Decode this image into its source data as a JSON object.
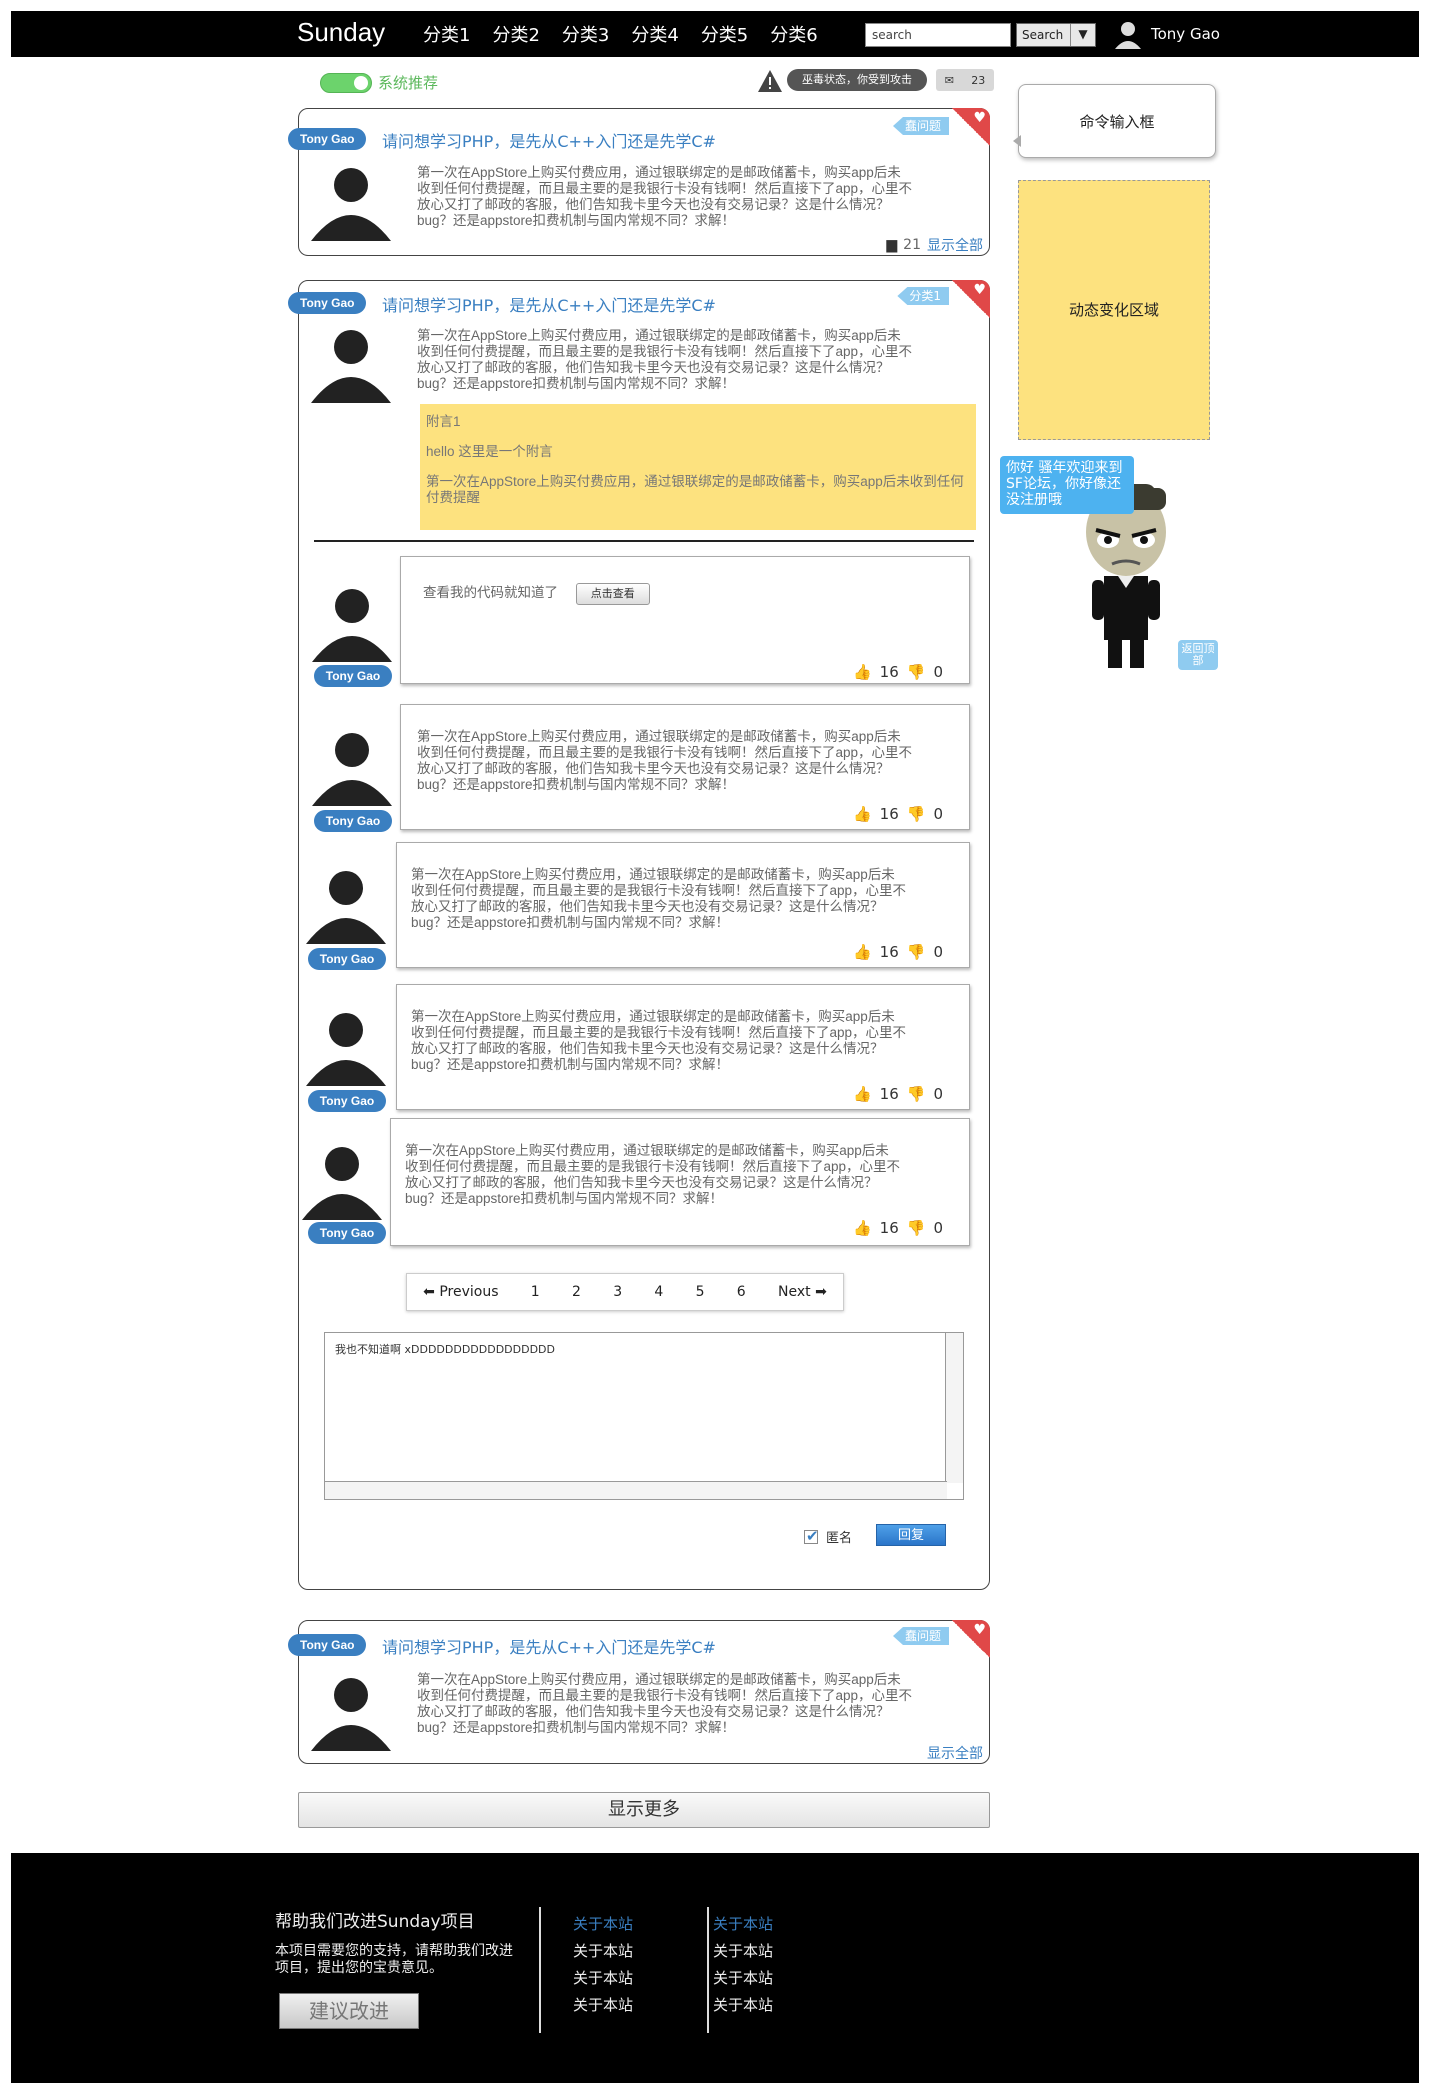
{
  "nav": {
    "brand": "Sunday",
    "categories": [
      "分类1",
      "分类2",
      "分类3",
      "分类4",
      "分类5",
      "分类6"
    ],
    "search_placeholder": "search",
    "search_button": "Search",
    "user": "Tony Gao"
  },
  "toolbar": {
    "toggle_label": "系统推荐",
    "status": "巫毒状态，你受到攻击",
    "mail_count": "23"
  },
  "posts": [
    {
      "author": "Tony Gao",
      "title": "请问想学习PHP，是先从C++入门还是先学C#",
      "ribbon": "蠢问题",
      "text": [
        "第一次在AppStore上购买付费应用，通过银联绑定的是邮政储蓄卡，购买app后未",
        "收到任何付费提醒，而且最主要的是我银行卡没有钱啊！然后直接下了app，心里不",
        "放心又打了邮政的客服，他们告知我卡里今天也没有交易记录？这是什么情况？",
        "bug？还是appstore扣费机制与国内常规不同？求解！"
      ],
      "comments": "21",
      "show_all": "显示全部"
    },
    {
      "author": "Tony Gao",
      "title": "请问想学习PHP，是先从C++入门还是先学C#",
      "ribbon": "分类1",
      "text": [
        "第一次在AppStore上购买付费应用，通过银联绑定的是邮政储蓄卡，购买app后未",
        "收到任何付费提醒，而且最主要的是我银行卡没有钱啊！然后直接下了app，心里不",
        "放心又打了邮政的客服，他们告知我卡里今天也没有交易记录？这是什么情况？",
        "bug？还是appstore扣费机制与国内常规不同？求解！"
      ],
      "note": {
        "title": "附言1",
        "line1": "hello 这里是一个附言",
        "line2": "第一次在AppStore上购买付费应用，通过银联绑定的是邮政储蓄卡，购买app后未收到任何付费提醒"
      }
    },
    {
      "author": "Tony Gao",
      "title": "请问想学习PHP，是先从C++入门还是先学C#",
      "ribbon": "蠢问题",
      "text": [
        "第一次在AppStore上购买付费应用，通过银联绑定的是邮政储蓄卡，购买app后未",
        "收到任何付费提醒，而且最主要的是我银行卡没有钱啊！然后直接下了app，心里不",
        "放心又打了邮政的客服，他们告知我卡里今天也没有交易记录？这是什么情况？",
        "bug？还是appstore扣费机制与国内常规不同？求解！"
      ],
      "show_all": "显示全部"
    }
  ],
  "replies": {
    "first": {
      "author": "Tony Gao",
      "text": "查看我的代码就知道了",
      "button": "点击查看",
      "up": "16",
      "down": "0"
    },
    "items": [
      {
        "author": "Tony Gao",
        "up": "16",
        "down": "0"
      },
      {
        "author": "Tony Gao",
        "up": "16",
        "down": "0"
      },
      {
        "author": "Tony Gao",
        "up": "16",
        "down": "0"
      },
      {
        "author": "Tony Gao",
        "up": "16",
        "down": "0"
      }
    ],
    "text": [
      "第一次在AppStore上购买付费应用，通过银联绑定的是邮政储蓄卡，购买app后未",
      "收到任何付费提醒，而且最主要的是我银行卡没有钱啊！然后直接下了app，心里不",
      "放心又打了邮政的客服，他们告知我卡里今天也没有交易记录？这是什么情况？",
      "bug？还是appstore扣费机制与国内常规不同？求解！"
    ]
  },
  "pager": {
    "prev": "Previous",
    "pages": [
      "1",
      "2",
      "3",
      "4",
      "5",
      "6"
    ],
    "next": "Next"
  },
  "compose": {
    "text": "我也不知道啊 xDDDDDDDDDDDDDDDDD",
    "anon": "匿名",
    "reply": "回复"
  },
  "more": "显示更多",
  "sidebar": {
    "cmd": "命令输入框",
    "dynamic": "动态变化区域",
    "speech": "你好 骚年欢迎来到SF论坛，你好像还没注册哦",
    "backtop": "返回顶部"
  },
  "footer": {
    "title": "帮助我们改进Sunday项目",
    "desc": "本项目需要您的支持，请帮助我们改进项目，提出您的宝贵意见。",
    "button": "建议改进",
    "col1": [
      "关于本站",
      "关于本站",
      "关于本站",
      "关于本站"
    ],
    "col2": [
      "关于本站",
      "关于本站",
      "关于本站",
      "关于本站"
    ]
  },
  "colors": {
    "accent": "#3a7fc1",
    "note": "#fde27f",
    "corner": "#e04848",
    "ribbon": "#8fcbf0",
    "toggle": "#6cd36c"
  }
}
